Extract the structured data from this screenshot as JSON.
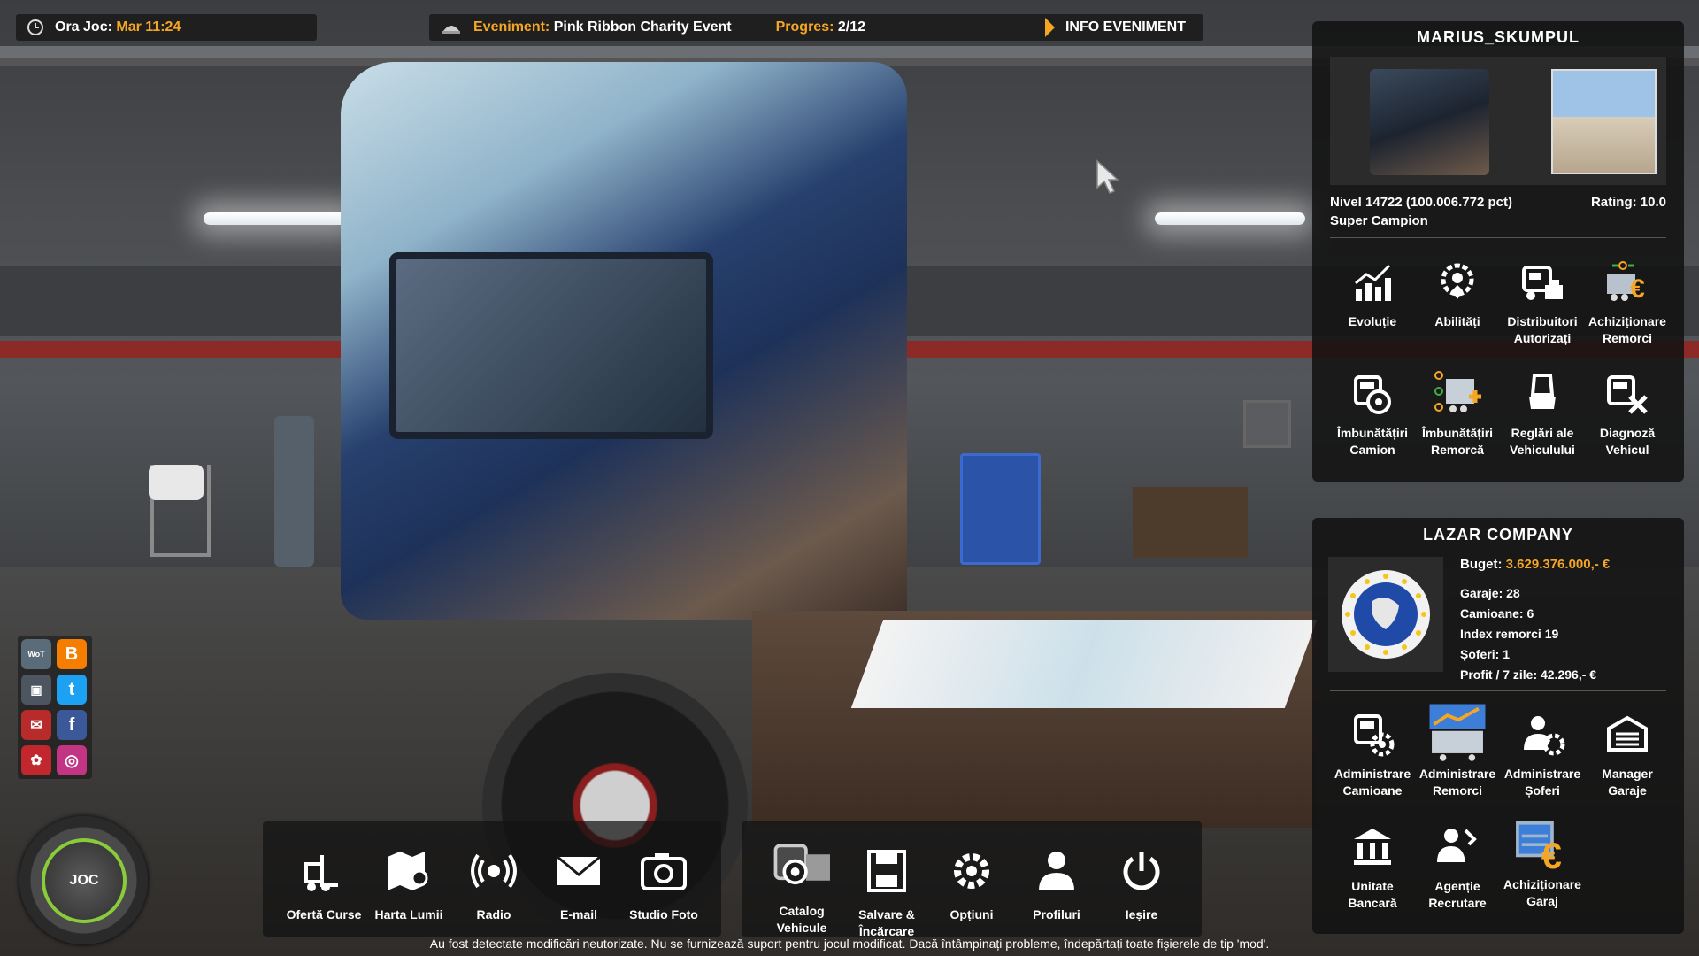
{
  "topbar": {
    "clock_label": "Ora Joc:",
    "clock_value": "Mar 11:24",
    "event_label": "Eveniment:",
    "event_value": "Pink Ribbon Charity Event",
    "progress_label": "Progres:",
    "progress_value": "2/12",
    "info_button": "INFO EVENIMENT"
  },
  "profile": {
    "name": "MARIUS_SKUMPUL",
    "level_text": "Nivel 14722 (100.006.772 pct)",
    "rank": "Super Campion",
    "rating": "Rating: 10.0",
    "items": [
      {
        "label1": "Evoluție",
        "label2": "",
        "icon": "chart-up-icon"
      },
      {
        "label1": "Abilități",
        "label2": "",
        "icon": "skills-icon"
      },
      {
        "label1": "Distribuitori",
        "label2": "Autorizați",
        "icon": "dealer-truck-icon"
      },
      {
        "label1": "Achiziționare",
        "label2": "Remorci",
        "icon": "buy-trailer-icon"
      },
      {
        "label1": "Îmbunătățiri",
        "label2": "Camion",
        "icon": "truck-upgrade-icon"
      },
      {
        "label1": "Îmbunătățiri",
        "label2": "Remorcă",
        "icon": "trailer-upgrade-icon"
      },
      {
        "label1": "Reglări ale",
        "label2": "Vehiculului",
        "icon": "seat-adjust-icon"
      },
      {
        "label1": "Diagnoză",
        "label2": "Vehicul",
        "icon": "diagnosis-icon"
      }
    ]
  },
  "company": {
    "name": "LAZAR COMPANY",
    "budget_label": "Buget:",
    "budget_value": "3.629.376.000,- €",
    "stats": [
      "Garaje: 28",
      "Camioane: 6",
      "Index remorci 19",
      "Șoferi: 1",
      "Profit / 7 zile: 42.296,- €"
    ],
    "items": [
      {
        "label1": "Administrare",
        "label2": "Camioane",
        "icon": "truck-manage-icon"
      },
      {
        "label1": "Administrare",
        "label2": "Remorci",
        "icon": "trailer-manage-icon"
      },
      {
        "label1": "Administrare",
        "label2": "Șoferi",
        "icon": "driver-manage-icon"
      },
      {
        "label1": "Manager",
        "label2": "Garaje",
        "icon": "garage-icon"
      },
      {
        "label1": "Unitate",
        "label2": "Bancară",
        "icon": "bank-icon"
      },
      {
        "label1": "Agenție",
        "label2": "Recrutare",
        "icon": "recruit-icon"
      },
      {
        "label1": "Achiziționare",
        "label2": "Garaj",
        "icon": "buy-garage-icon"
      }
    ]
  },
  "dock_left": [
    {
      "label1": "Ofertă Curse",
      "label2": "",
      "icon": "forklift-icon"
    },
    {
      "label1": "Harta Lumii",
      "label2": "",
      "icon": "map-icon"
    },
    {
      "label1": "Radio",
      "label2": "",
      "icon": "radio-icon"
    },
    {
      "label1": "E-mail",
      "label2": "",
      "icon": "mail-icon"
    },
    {
      "label1": "Studio Foto",
      "label2": "",
      "icon": "camera-icon"
    }
  ],
  "dock_right": [
    {
      "label1": "Catalog",
      "label2": "Vehicule",
      "icon": "vehicle-catalog-icon"
    },
    {
      "label1": "Salvare &",
      "label2": "Încărcare",
      "icon": "save-icon"
    },
    {
      "label1": "Opțiuni",
      "label2": "",
      "icon": "gear-icon"
    },
    {
      "label1": "Profiluri",
      "label2": "",
      "icon": "profiles-icon"
    },
    {
      "label1": "Ieșire",
      "label2": "",
      "icon": "power-icon"
    }
  ],
  "joc_button": "JOC",
  "warning": "Au fost detectate modificări neutorizate. Nu se furnizează suport pentru jocul modificat. Dacă întâmpinați probleme, îndepărtați toate fișierele de tip 'mod'.",
  "social": [
    {
      "name": "world-of-trucks-icon",
      "color": "#5a6b7a"
    },
    {
      "name": "blogger-icon",
      "color": "#f57d00"
    },
    {
      "name": "steam-truck-icon",
      "color": "#4d5560"
    },
    {
      "name": "twitter-icon",
      "color": "#1da1f2"
    },
    {
      "name": "forum-icon",
      "color": "#b72b2b"
    },
    {
      "name": "facebook-icon",
      "color": "#3b5998"
    },
    {
      "name": "scs-logo-icon",
      "color": "#c1272d"
    },
    {
      "name": "instagram-icon",
      "color": "#c13584"
    }
  ],
  "accent": "#f5a623",
  "joc_ring": "#8acb3c"
}
